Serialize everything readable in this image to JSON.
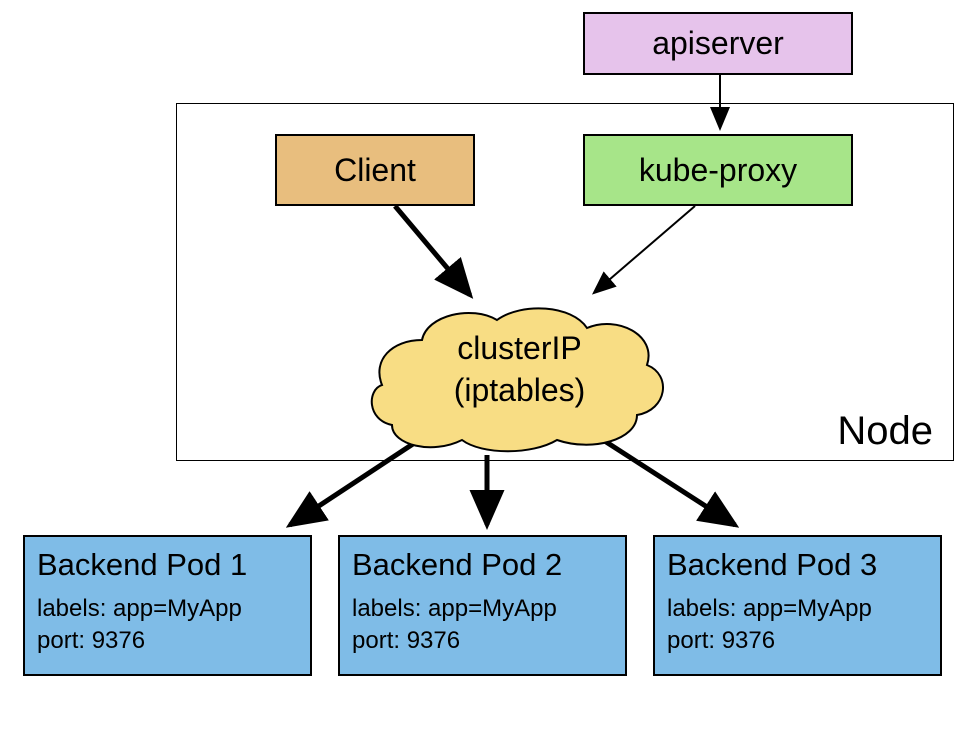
{
  "apiserver": {
    "label": "apiserver"
  },
  "node": {
    "label": "Node"
  },
  "client": {
    "label": "Client"
  },
  "kubeproxy": {
    "label": "kube-proxy"
  },
  "clusterip": {
    "line1": "clusterIP",
    "line2": "(iptables)"
  },
  "pods": [
    {
      "title": "Backend Pod 1",
      "labels": "labels: app=MyApp",
      "port": "port: 9376"
    },
    {
      "title": "Backend Pod 2",
      "labels": "labels: app=MyApp",
      "port": "port: 9376"
    },
    {
      "title": "Backend Pod 3",
      "labels": "labels: app=MyApp",
      "port": "port: 9376"
    }
  ]
}
